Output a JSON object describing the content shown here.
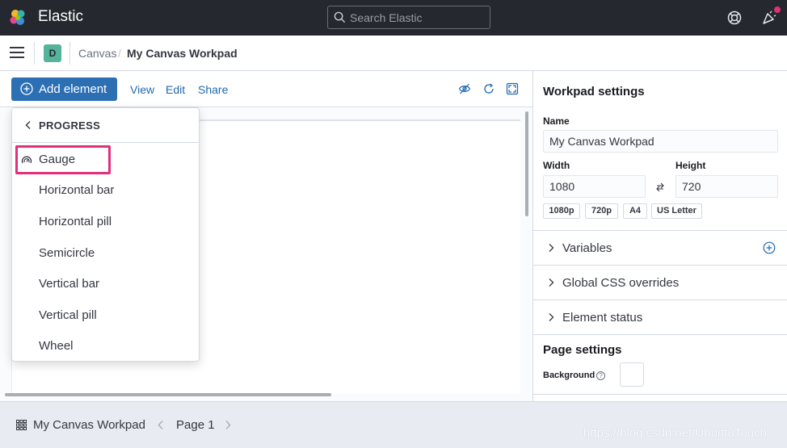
{
  "header": {
    "brand": "Elastic",
    "search_placeholder": "Search Elastic"
  },
  "breadcrumbs": {
    "space_initial": "D",
    "parent": "Canvas",
    "separator": "/",
    "current": "My Canvas Workpad"
  },
  "toolbar": {
    "add_element": "Add element",
    "view": "View",
    "edit": "Edit",
    "share": "Share"
  },
  "dropdown": {
    "title": "PROGRESS",
    "items": [
      "Gauge",
      "Horizontal bar",
      "Horizontal pill",
      "Semicircle",
      "Vertical bar",
      "Vertical pill",
      "Wheel"
    ]
  },
  "panel": {
    "title": "Workpad settings",
    "name_label": "Name",
    "name_value": "My Canvas Workpad",
    "width_label": "Width",
    "width_value": "1080",
    "height_label": "Height",
    "height_value": "720",
    "presets": [
      "1080p",
      "720p",
      "A4",
      "US Letter"
    ],
    "accordions": [
      "Variables",
      "Global CSS overrides",
      "Element status"
    ],
    "page_settings_title": "Page settings",
    "background_label": "Background",
    "background_color": "#ffffff"
  },
  "footer": {
    "workpad_title": "My Canvas Workpad",
    "page_label": "Page 1"
  },
  "watermark": "https://blog.csdn.net/UbuntuTouch",
  "colors": {
    "header_bg": "#25282f",
    "primary": "#2c6fb3",
    "link": "#1f67b0",
    "highlight": "#e0307c",
    "notification": "#e0307c",
    "space_avatar": "#54b399"
  }
}
